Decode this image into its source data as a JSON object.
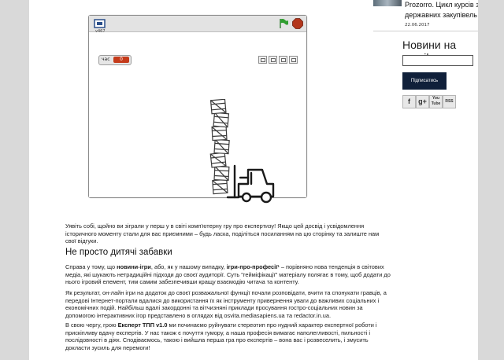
{
  "game": {
    "version_label": "v467",
    "timer_label": "час",
    "timer_value": "0"
  },
  "sidebar": {
    "article_title": "Prozorro. Цикл курсів з державних закупівель",
    "article_date": "22.06.2017",
    "newsletter_title": "Новини на email",
    "email_value": "",
    "subscribe_label": "Підписатись",
    "social": [
      "f",
      "g+",
      "You Tube",
      "RSS"
    ]
  },
  "article": {
    "p1": "Уявіть собі, щойно ви зіграли у перш у в світі комп'ютерну гру про експертизу! Якщо цей досвід і усвідомлення історичного моменту стали  для вас приємними – будь ласка, поділіться посиланням на цю сторінку та залиште нам свої відгуки.",
    "h2": "Не просто дитячі забавки",
    "p2_a": "Справа у тому, що ",
    "p2_b": "новини-ігри",
    "p2_c": ", або, як у нашому випадку, ",
    "p2_d": "ігри-про-професії",
    "p2_e": "¹ – порівняно нова тенденція в світових медіа, які шукають нетрадиційні підходи до своєї аудиторії. Суть \"гейміфікації\" матеріалу полягає в тому, щоб додати до нього ігровий елемент, тим самим забезпечивши кращу взаємодію читача та контенту.",
    "p3": "Як результат, он-лайн ігри на додаток до своєї розважальної функції почали розповідати, вчити та спонукати гравців, а передові Інтернет-портали вдалися до використання їх як інструменту привернення уваги до важливих соціальних  і економічних подій. Найбільш вдалі закордонні та вітчизняні приклади просування гостро-соціальних новин за допомогою інтерактивних ігор представлено в оглядах від osvita.mediasapiens.ua та redactor.in.ua.",
    "p4_a": "В свою чергу, грою ",
    "p4_b": "Експерт ТПП v1.0",
    "p4_c": " ми починаємо руйнувати стереотип про нудний характер експертної роботи і прискіпливу вдачу експертів. У нас також є почуття гумору, а наша професія вимагає наполегливості, пильності і послідовності в діях. Сподіваємось, такою і вийшла перша гра про експертів – вона вас і розвеселить, і змусить докласти зусиль для перемоги!"
  },
  "colors": {
    "subscribe_bg": "#10203a",
    "timer_value_bg": "#c53b1b",
    "flag": "#2f9e2f",
    "stop": "#b3361c"
  }
}
